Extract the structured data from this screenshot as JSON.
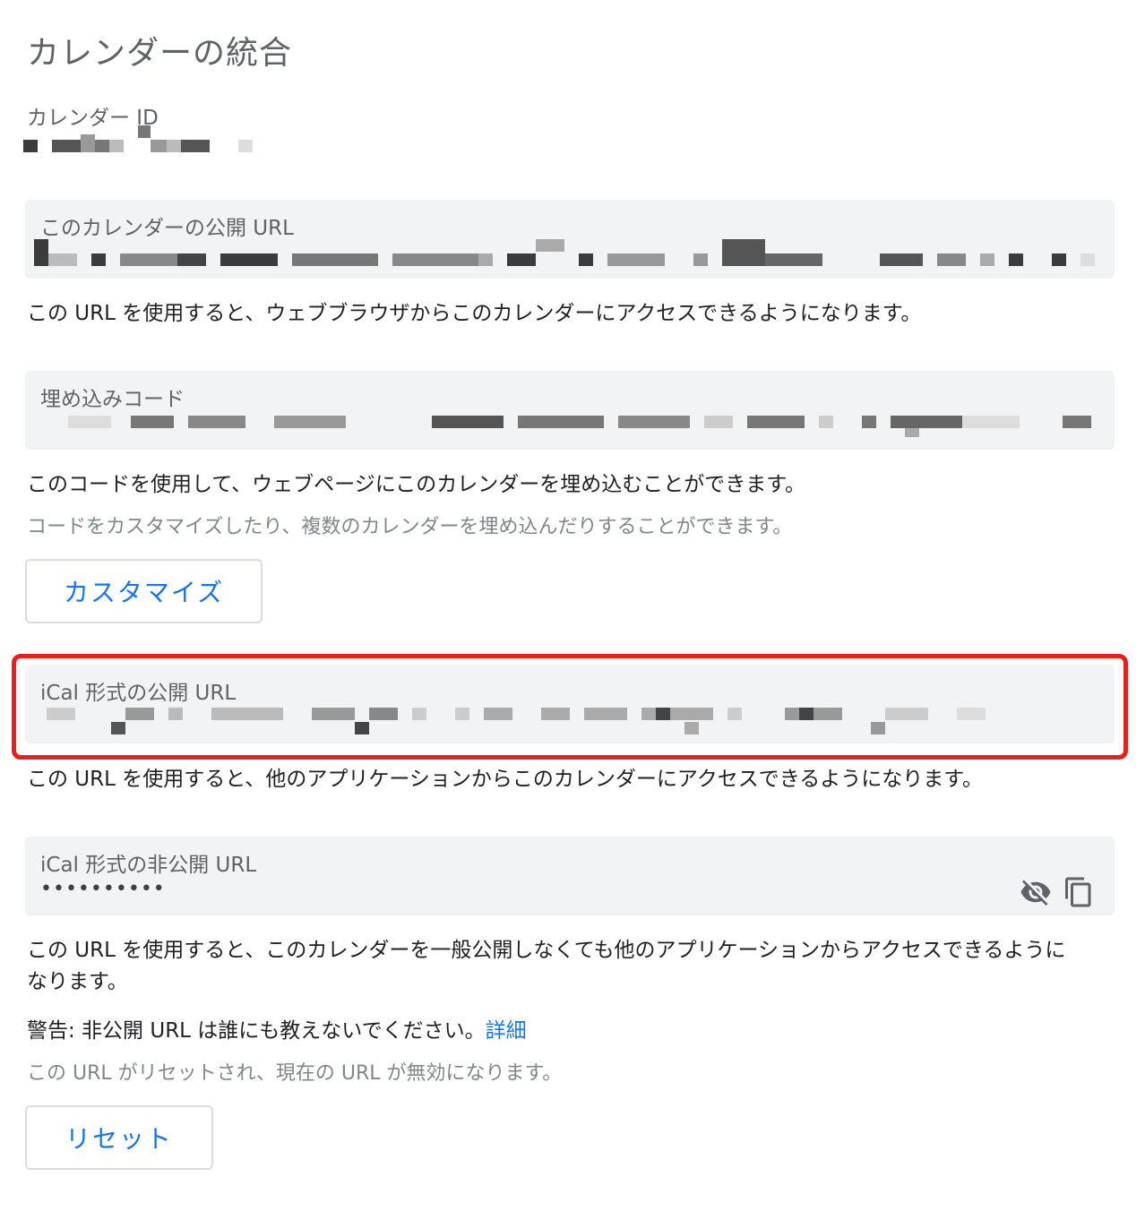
{
  "page_title": "カレンダーの統合",
  "calendar_id": {
    "label": "カレンダー ID"
  },
  "public_url": {
    "label": "このカレンダーの公開 URL",
    "description": "この URL を使用すると、ウェブブラウザからこのカレンダーにアクセスできるようになります。"
  },
  "embed_code": {
    "label": "埋め込みコード",
    "description": "このコードを使用して、ウェブページにこのカレンダーを埋め込むことができます。",
    "sub_description": "コードをカスタマイズしたり、複数のカレンダーを埋め込んだりすることができます。",
    "customize_button": "カスタマイズ"
  },
  "ical_public": {
    "label": "iCal 形式の公開 URL",
    "description": "この URL を使用すると、他のアプリケーションからこのカレンダーにアクセスできるようになります。",
    "highlight_color": "#e8201b"
  },
  "ical_private": {
    "label": "iCal 形式の非公開 URL",
    "value": "••••••••••",
    "icons": [
      "visibility-off-icon",
      "copy-icon"
    ],
    "description_line1": "この URL を使用すると、このカレンダーを一般公開しなくても他のアプリケーションからアクセスできるように",
    "description_line2": "なります。",
    "warning_text": "警告: 非公開 URL は誰にも教えないでください。",
    "warning_link": "詳細",
    "reset_note": "この URL がリセットされ、現在の URL が無効になります。",
    "reset_button": "リセット"
  },
  "colors": {
    "accent": "#1a73e8",
    "field_bg": "#f1f3f4",
    "highlight": "#e8201b"
  }
}
